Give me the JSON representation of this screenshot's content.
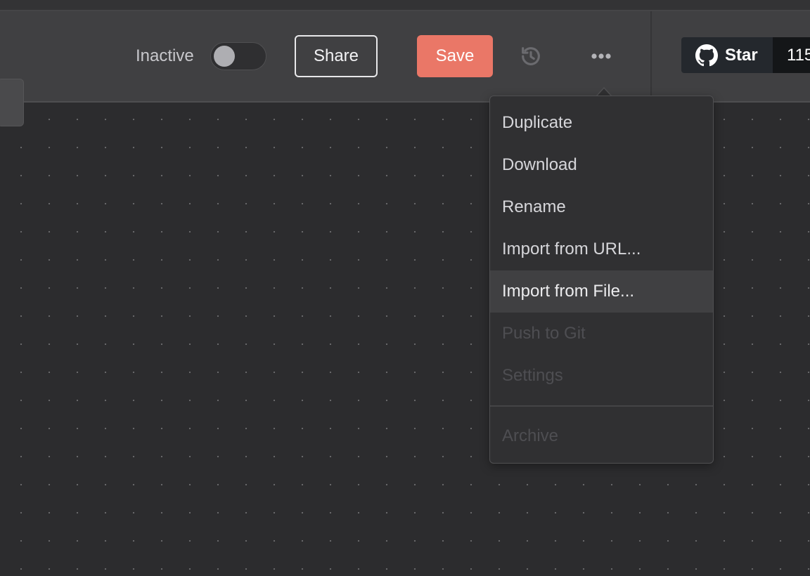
{
  "header": {
    "status_label": "Inactive",
    "active": false,
    "share_label": "Share",
    "save_label": "Save"
  },
  "github": {
    "star_label": "Star",
    "count": "115"
  },
  "menu": {
    "items": [
      {
        "label": "Duplicate",
        "state": "normal"
      },
      {
        "label": "Download",
        "state": "normal"
      },
      {
        "label": "Rename",
        "state": "normal"
      },
      {
        "label": "Import from URL...",
        "state": "normal"
      },
      {
        "label": "Import from File...",
        "state": "hover"
      },
      {
        "label": "Push to Git",
        "state": "disabled"
      },
      {
        "label": "Settings",
        "state": "disabled"
      }
    ],
    "footer_items": [
      {
        "label": "Archive",
        "state": "disabled"
      }
    ]
  },
  "colors": {
    "accent": "#ea7767",
    "header_bg": "#404042",
    "canvas_bg": "#2c2c2e",
    "menu_bg": "#303032"
  },
  "icons": {
    "history": "history-icon",
    "more": "more-horizontal-icon",
    "github": "github-icon"
  }
}
